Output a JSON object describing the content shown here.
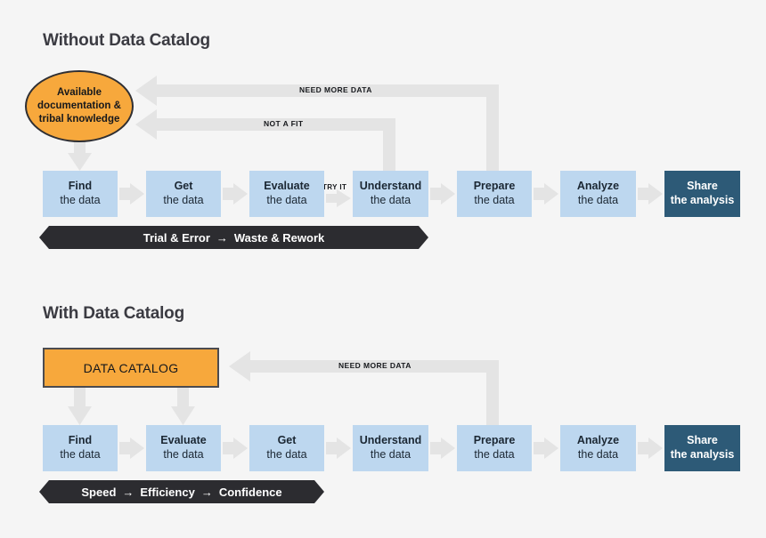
{
  "sections": {
    "without": {
      "title": "Without Data Catalog",
      "source_node": "Available documentation & tribal knowledge",
      "steps": [
        {
          "line1": "Find",
          "line2": "the data"
        },
        {
          "line1": "Get",
          "line2": "the data"
        },
        {
          "line1": "Evaluate",
          "line2": "the data"
        },
        {
          "line1": "Understand",
          "line2": "the data"
        },
        {
          "line1": "Prepare",
          "line2": "the data"
        },
        {
          "line1": "Analyze",
          "line2": "the data"
        },
        {
          "line1": "Share",
          "line2": "the analysis"
        }
      ],
      "feedback_labels": {
        "need_more_data": "NEED MORE DATA",
        "not_a_fit": "NOT A FIT",
        "try_it": "TRY IT"
      },
      "banner": {
        "part1": "Trial & Error",
        "arrow": "→",
        "part2": "Waste & Rework"
      }
    },
    "with": {
      "title": "With Data Catalog",
      "source_node": "DATA CATALOG",
      "steps": [
        {
          "line1": "Find",
          "line2": "the data"
        },
        {
          "line1": "Evaluate",
          "line2": "the data"
        },
        {
          "line1": "Get",
          "line2": "the data"
        },
        {
          "line1": "Understand",
          "line2": "the data"
        },
        {
          "line1": "Prepare",
          "line2": "the data"
        },
        {
          "line1": "Analyze",
          "line2": "the data"
        },
        {
          "line1": "Share",
          "line2": "the analysis"
        }
      ],
      "feedback_labels": {
        "need_more_data": "NEED MORE DATA"
      },
      "banner": {
        "part1": "Speed",
        "arrow1": "→",
        "part2": "Efficiency",
        "arrow2": "→",
        "part3": "Confidence"
      }
    }
  },
  "colors": {
    "background": "#f5f5f5",
    "step_fill": "#bdd7ef",
    "step_final_fill": "#2d5a77",
    "accent_orange": "#f7a83c",
    "connector_gray": "#e4e4e4",
    "banner_dark": "#2c2c30",
    "text_dark": "#3b3b42"
  }
}
